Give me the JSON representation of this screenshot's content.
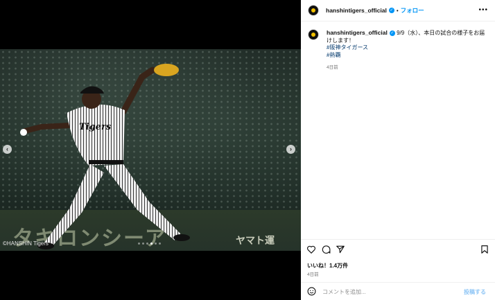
{
  "media": {
    "copyright": "©HANSHIN Tigers",
    "ad_text_left": "タキロンシーア",
    "ad_text_right": "ヤマト運",
    "jersey_text": "Tigers",
    "carousel": {
      "total": 6,
      "active": 4
    }
  },
  "header": {
    "username": "hanshintigers_official",
    "separator": "•",
    "follow_label": "フォロー",
    "more_icon": "more-horizontal-icon"
  },
  "caption": {
    "username": "hanshintigers_official",
    "text": "9/9（水）、本日の試合の様子をお届けします！",
    "hashtags": [
      "#阪神タイガース",
      "#熱覇"
    ],
    "time": "4日前"
  },
  "actions": {
    "likes": "いいね！1.4万件",
    "time": "4日前"
  },
  "comment": {
    "placeholder": "コメントを追加...",
    "post_label": "投稿する"
  },
  "colors": {
    "accent": "#0095f6",
    "hashtag": "#00376b",
    "brand": "#f2c100"
  }
}
